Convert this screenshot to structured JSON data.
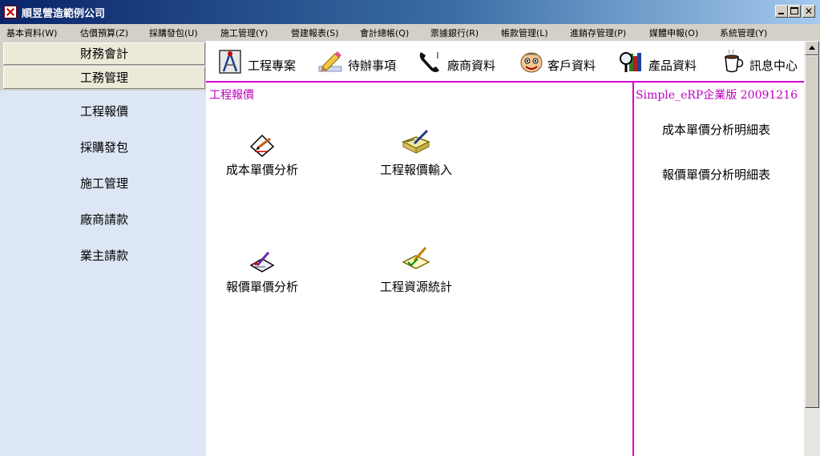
{
  "window": {
    "title": "順昱營造範例公司"
  },
  "menu": [
    "基本資料(W)",
    "估價預算(Z)",
    "採購發包(U)",
    "施工管理(Y)",
    "營建報表(S)",
    "會計總帳(Q)",
    "票據銀行(R)",
    "帳款管理(L)",
    "進銷存管理(P)",
    "媒體申報(O)",
    "系統管理(Y)"
  ],
  "sidebar": {
    "groups": [
      "財務會計",
      "工務管理"
    ],
    "items": [
      "工程報價",
      "採購發包",
      "施工管理",
      "廠商請款",
      "業主請款"
    ]
  },
  "toolbar": {
    "buttons": [
      {
        "label": "工程專案",
        "icon": "drafting-compass-icon"
      },
      {
        "label": "待辦事項",
        "icon": "pencil-icon"
      },
      {
        "label": "廠商資料",
        "icon": "telephone-icon"
      },
      {
        "label": "客戶資料",
        "icon": "face-icon"
      },
      {
        "label": "產品資料",
        "icon": "magnifier-books-icon"
      },
      {
        "label": "訊息中心",
        "icon": "coffee-cup-icon"
      }
    ]
  },
  "main": {
    "section_title": "工程報價",
    "functions": [
      {
        "label": "成本單價分析",
        "icon": "pen-paper-icon"
      },
      {
        "label": "工程報價輸入",
        "icon": "book-pen-icon"
      },
      {
        "label": "報價單價分析",
        "icon": "note-pen-icon"
      },
      {
        "label": "工程資源統計",
        "icon": "note-check-icon"
      }
    ]
  },
  "right": {
    "version": "Simple_eRP企業版 20091216",
    "reports": [
      "成本單價分析明細表",
      "報價單價分析明細表"
    ]
  },
  "colors": {
    "accent": "#c000c0",
    "sidebar_bg": "#dce6f4",
    "titlebar": "#0a246a"
  }
}
